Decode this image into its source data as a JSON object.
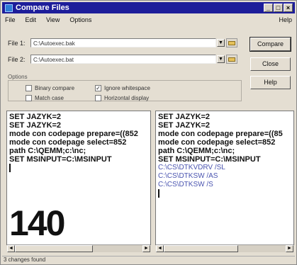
{
  "window": {
    "title": "Compare Files"
  },
  "titlebar_buttons": {
    "minimize": "_",
    "maximize": "□",
    "close": "×"
  },
  "menu": {
    "items": [
      "File",
      "Edit",
      "View",
      "Options"
    ],
    "help": "Help"
  },
  "file1": {
    "label": "File 1:",
    "value": "C:\\Autoexec.bak"
  },
  "file2": {
    "label": "File 2:",
    "value": "C:\\Autoexec.bat"
  },
  "buttons": {
    "compare": "Compare",
    "close": "Close",
    "help": "Help"
  },
  "options": {
    "title": "Options",
    "binary_compare": {
      "label": "Binary compare",
      "checked": false
    },
    "match_case": {
      "label": "Match case",
      "checked": false
    },
    "ignore_whitespace": {
      "label": "Ignore whitespace",
      "checked": true
    },
    "horizontal_display": {
      "label": "Horizontal display",
      "checked": false
    }
  },
  "left_pane": {
    "lines": [
      "SET JAZYK=2",
      "SET JAZYK=2",
      "mode con codepage prepare=((852",
      "mode con codepage select=852",
      "path C:\\QEMM;c:\\nc;",
      "SET MSINPUT=C:\\MSINPUT"
    ]
  },
  "right_pane": {
    "lines": [
      "SET JAZYK=2",
      "SET JAZYK=2",
      "mode con codepage prepare=((85",
      "mode con codepage select=852",
      "path C:\\QEMM;c:\\nc;",
      "SET MSINPUT=C:\\MSINPUT"
    ],
    "added_lines": [
      "C:\\CS\\DTKVDRV /SL",
      "C:\\CS\\DTKSW /AS",
      "C:\\CS\\DTKSW /S"
    ]
  },
  "page_number": "140",
  "status": {
    "text": "3 changes found"
  },
  "colors": {
    "titlebar": "#1d1d9a",
    "added_text": "#4a54b0"
  }
}
